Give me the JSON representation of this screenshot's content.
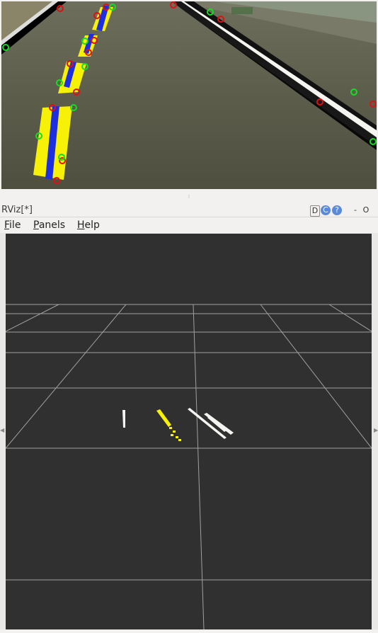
{
  "window": {
    "title": "RViz[*]",
    "controls": [
      "D",
      "C",
      "?",
      "-",
      "O"
    ]
  },
  "menubar": {
    "items": [
      {
        "label": "File",
        "mnemonic": "F",
        "rest": "ile"
      },
      {
        "label": "Panels",
        "mnemonic": "P",
        "rest": "anels"
      },
      {
        "label": "Help",
        "mnemonic": "H",
        "rest": "elp"
      }
    ]
  },
  "colors": {
    "viewport_bg": "#303030",
    "grid": "#a0a0a0",
    "lane_yellow": "#f7f007",
    "lane_blue": "#1e2fe0",
    "marker_red": "#e01010",
    "marker_green": "#10e020",
    "road": "#5a5a4a",
    "curb_white": "#f4f4f0"
  },
  "icons": {
    "minimize": "minimize-icon",
    "maximize": "maximize-icon",
    "help": "help-icon",
    "refresh": "refresh-icon"
  }
}
